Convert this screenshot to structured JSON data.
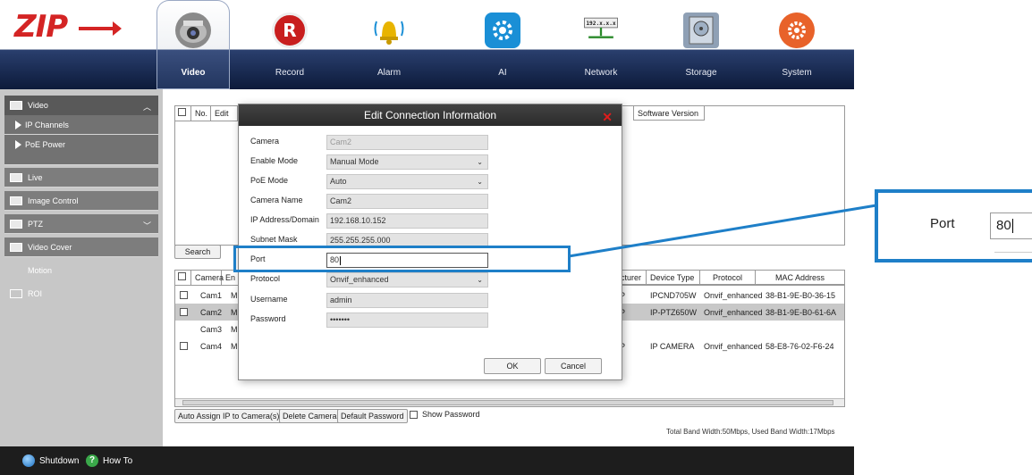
{
  "logo": {
    "text": "ZIP"
  },
  "nav": [
    {
      "label": "Video",
      "icon": "camera-icon",
      "color": "#7a7a7a",
      "active": true
    },
    {
      "label": "Record",
      "icon": "record-icon",
      "color": "#c81e1e"
    },
    {
      "label": "Alarm",
      "icon": "bell-icon",
      "color": "#e8b400"
    },
    {
      "label": "AI",
      "icon": "ai-head-icon",
      "color": "#1a8fd6"
    },
    {
      "label": "Network",
      "icon": "network-icon",
      "color": "#555555",
      "badge": "192.x.x.x"
    },
    {
      "label": "Storage",
      "icon": "hard-drive-icon",
      "color": "#8fa0b5"
    },
    {
      "label": "System",
      "icon": "gear-icon",
      "color": "#e8622a"
    }
  ],
  "sidebar": {
    "header": "Video",
    "items": [
      {
        "label": "IP Channels",
        "type": "sub"
      },
      {
        "label": "PoE Power",
        "type": "sub"
      },
      {
        "label": "Live",
        "type": "item"
      },
      {
        "label": "Image Control",
        "type": "item"
      },
      {
        "label": "PTZ",
        "type": "item",
        "expand": true
      },
      {
        "label": "Video Cover",
        "type": "item"
      },
      {
        "label": "Motion",
        "type": "plain"
      },
      {
        "label": "ROI",
        "type": "plain"
      }
    ]
  },
  "top_table": {
    "headers": [
      "No.",
      "Edit"
    ],
    "right_header": "Software Version"
  },
  "search_label": "Search",
  "bottom_table": {
    "headers": [
      "Camera",
      "En",
      "cturer",
      "Device Type",
      "Protocol",
      "MAC Address"
    ],
    "rows": [
      {
        "camera": "Cam1",
        "en": "M",
        "p": "P",
        "device": "IPCND705W",
        "protocol": "Onvif_enhanced",
        "mac": "38-B1-9E-B0-36-15",
        "checkbox": true
      },
      {
        "camera": "Cam2",
        "en": "M",
        "p": "P",
        "device": "IP-PTZ650W",
        "protocol": "Onvif_enhanced",
        "mac": "38-B1-9E-B0-61-6A",
        "checkbox": true,
        "selected": true
      },
      {
        "camera": "Cam3",
        "en": "M",
        "p": "",
        "device": "",
        "protocol": "",
        "mac": "",
        "checkbox": false
      },
      {
        "camera": "Cam4",
        "en": "M",
        "p": "P",
        "device": "IP CAMERA",
        "protocol": "Onvif_enhanced",
        "mac": "58-E8-76-02-F6-24",
        "checkbox": true
      }
    ]
  },
  "buttons": {
    "auto_assign": "Auto Assign IP to Camera(s)",
    "delete_camera": "Delete Camera",
    "default_password": "Default Password",
    "show_password": "Show Password"
  },
  "bandwidth": "Total Band Width:50Mbps, Used Band Width:17Mbps",
  "footer": {
    "shutdown": "Shutdown",
    "howto": "How To"
  },
  "dialog": {
    "title": "Edit Connection Information",
    "fields": [
      {
        "label": "Camera",
        "value": "Cam2",
        "disabled": true
      },
      {
        "label": "Enable Mode",
        "value": "Manual Mode",
        "dropdown": true
      },
      {
        "label": "PoE Mode",
        "value": "Auto",
        "dropdown": true
      },
      {
        "label": "Camera Name",
        "value": "Cam2"
      },
      {
        "label": "IP Address/Domain",
        "value": "192.168.10.152"
      },
      {
        "label": "Subnet Mask",
        "value": "255.255.255.000"
      },
      {
        "label": "Port",
        "value": "80",
        "focus": true
      },
      {
        "label": "Protocol",
        "value": "Onvif_enhanced",
        "dropdown": true
      },
      {
        "label": "Username",
        "value": "admin"
      },
      {
        "label": "Password",
        "value": "•••••••"
      }
    ],
    "ok": "OK",
    "cancel": "Cancel"
  },
  "zoom": {
    "label": "Port",
    "value": "80"
  },
  "colors": {
    "highlight": "#1e7fc8",
    "close": "#e01c1c",
    "header_dark": "#0c1a3a"
  }
}
